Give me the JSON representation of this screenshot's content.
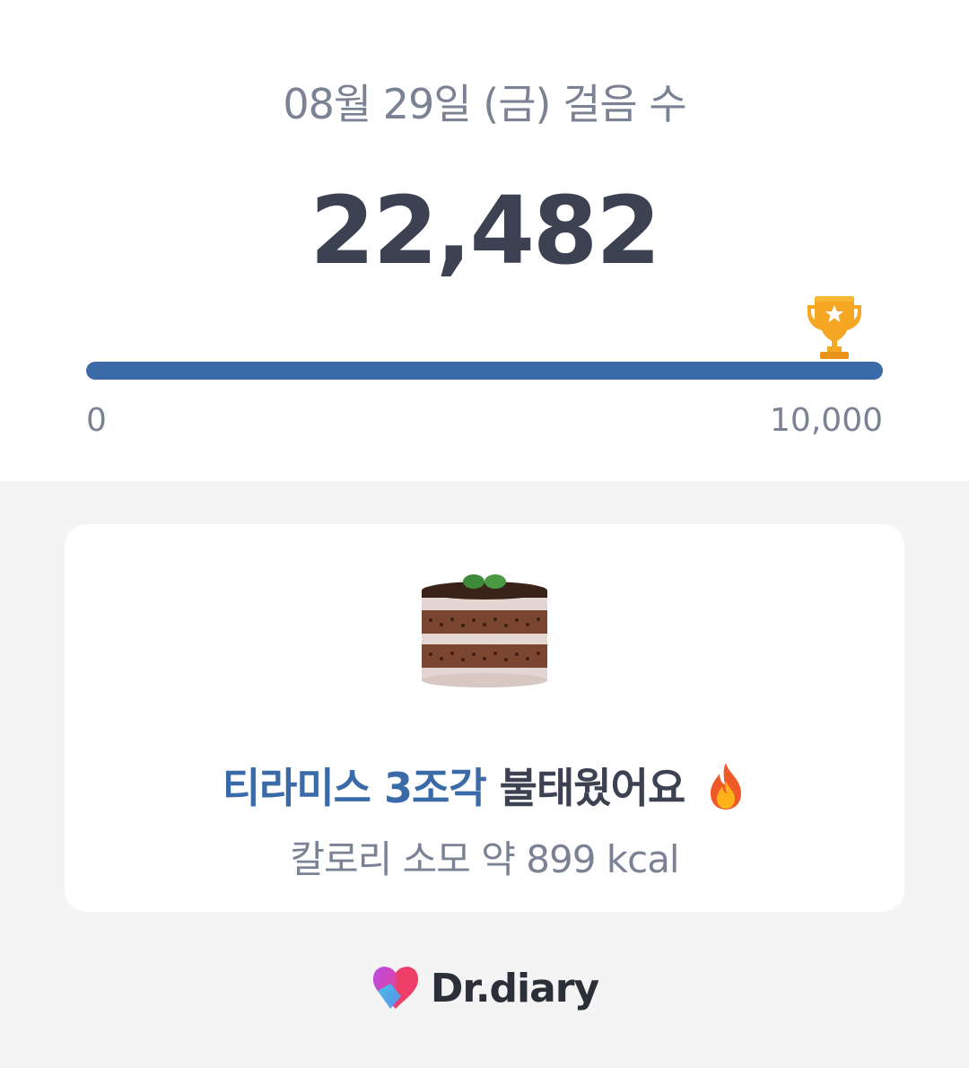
{
  "header": {
    "date_title": "08월 29일 (금) 걸음 수",
    "step_count": "22,482"
  },
  "progress": {
    "min_label": "0",
    "max_label": "10,000",
    "fraction": 1.0,
    "bar_color": "#3a6aa8",
    "goal_icon": "trophy-icon"
  },
  "card": {
    "food_icon": "tiramisu-cake-icon",
    "burn_highlight": "티라미스 3조각",
    "burn_text": "불태웠어요",
    "burn_icon": "fire-icon",
    "kcal_text": "칼로리 소모 약 899 kcal"
  },
  "brand": {
    "name": "Dr.diary",
    "logo_icon": "dr-diary-heart-logo"
  },
  "colors": {
    "accent": "#3a6aa8",
    "text_dark": "#3c4252",
    "text_muted": "#7a8294",
    "background": "#f4f4f4"
  }
}
